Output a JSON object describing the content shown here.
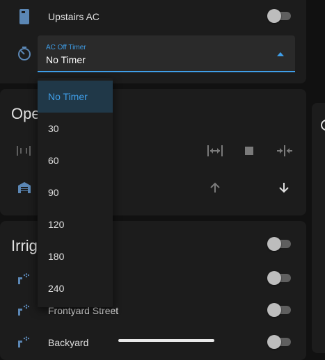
{
  "upstairs_ac": {
    "label": "Upstairs AC",
    "icon": "air-conditioner-icon",
    "toggle_on": false
  },
  "timer_select": {
    "icon": "timer-icon",
    "floating_label": "AC Off Timer",
    "value": "No Timer",
    "arrow_icon": "arrow-up-icon"
  },
  "timer_menu": {
    "options": [
      "No Timer",
      "30",
      "60",
      "90",
      "120",
      "180",
      "240"
    ],
    "selected": "No Timer"
  },
  "opener_card": {
    "title_partial": "Ope",
    "row1": {
      "icon": "door-sliding-icon",
      "controls": [
        "open-horizontal-icon",
        "stop-icon",
        "close-horizontal-icon"
      ]
    },
    "row2": {
      "icon": "garage-icon",
      "controls": [
        "arrow-up-icon",
        "arrow-down-icon"
      ]
    }
  },
  "irrigation_card": {
    "title_partial": "Irrig",
    "rows": [
      {
        "label": "",
        "icon": "sprinkler-icon",
        "toggle_on": false
      },
      {
        "label": "Frontyard Street",
        "icon": "sprinkler-icon",
        "toggle_on": false
      },
      {
        "label": "Backyard",
        "icon": "sprinkler-icon",
        "toggle_on": false
      }
    ]
  },
  "colors": {
    "accent": "#3f9ee8",
    "card": "#1c1c1c",
    "background": "#111111",
    "icon": "#5b87b5"
  }
}
